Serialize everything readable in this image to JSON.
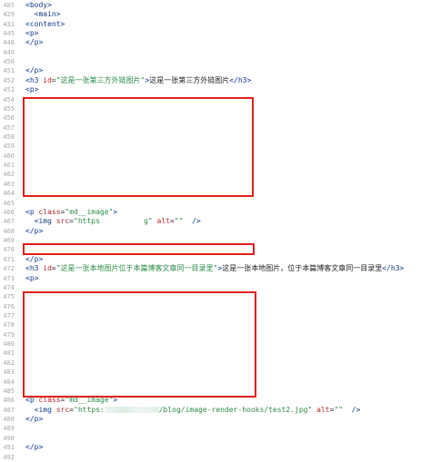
{
  "colors": {
    "tag": "#0f3a8a",
    "attribute": "#b0282e",
    "string": "#2d8a45",
    "text": "#222222",
    "line_number": "#a7a7a7",
    "highlight_box": "#e0201a"
  },
  "lines": [
    {
      "n": "485",
      "code": "<body>"
    },
    {
      "n": "429",
      "code": "  <main>"
    },
    {
      "n": "431",
      "code": "<content>"
    },
    {
      "n": "445",
      "code": "<p>"
    },
    {
      "n": "448",
      "code": "</p>"
    },
    {
      "n": "449",
      "code": ""
    },
    {
      "n": "450",
      "code": ""
    },
    {
      "n": "451",
      "code": "</p>"
    },
    {
      "n": "452",
      "code": "<h3 id=\"这是一张第三方外链图片\">这是一张第三方外链图片</h3>"
    },
    {
      "n": "453",
      "code": "<p>"
    },
    {
      "n": "454",
      "code": ""
    },
    {
      "n": "455",
      "code": ""
    },
    {
      "n": "456",
      "code": ""
    },
    {
      "n": "457",
      "code": ""
    },
    {
      "n": "458",
      "code": ""
    },
    {
      "n": "459",
      "code": ""
    },
    {
      "n": "460",
      "code": ""
    },
    {
      "n": "461",
      "code": ""
    },
    {
      "n": "462",
      "code": ""
    },
    {
      "n": "463",
      "code": ""
    },
    {
      "n": "464",
      "code": ""
    },
    {
      "n": "465",
      "code": ""
    },
    {
      "n": "466",
      "code": "<p class=\"md__image\">"
    },
    {
      "n": "467",
      "code": "  <img src=\"https          g\" alt=\"\"  />"
    },
    {
      "n": "468",
      "code": "</p>"
    },
    {
      "n": "469",
      "code": ""
    },
    {
      "n": "470",
      "code": ""
    },
    {
      "n": "471",
      "code": "</p>"
    },
    {
      "n": "472",
      "code": "<h3 id=\"这是一张本地图片位于本篇博客文章同一目录里\">这是一张本地图片，位于本篇博客文章同一目录里</h3>"
    },
    {
      "n": "473",
      "code": "<p>"
    },
    {
      "n": "474",
      "code": ""
    },
    {
      "n": "475",
      "code": ""
    },
    {
      "n": "476",
      "code": ""
    },
    {
      "n": "477",
      "code": ""
    },
    {
      "n": "478",
      "code": ""
    },
    {
      "n": "479",
      "code": ""
    },
    {
      "n": "480",
      "code": ""
    },
    {
      "n": "481",
      "code": ""
    },
    {
      "n": "482",
      "code": ""
    },
    {
      "n": "483",
      "code": ""
    },
    {
      "n": "484",
      "code": ""
    },
    {
      "n": "485",
      "code": ""
    },
    {
      "n": "486",
      "code": "<p class=\"md__image\">"
    },
    {
      "n": "487",
      "code": "  <img src=\"https:        /blog/image-render-hooks/test2.jpg\" alt=\"\"  />"
    },
    {
      "n": "488",
      "code": "</p>"
    },
    {
      "n": "489",
      "code": ""
    },
    {
      "n": "490",
      "code": ""
    },
    {
      "n": "491",
      "code": "</p>"
    },
    {
      "n": "492",
      "code": ""
    }
  ]
}
